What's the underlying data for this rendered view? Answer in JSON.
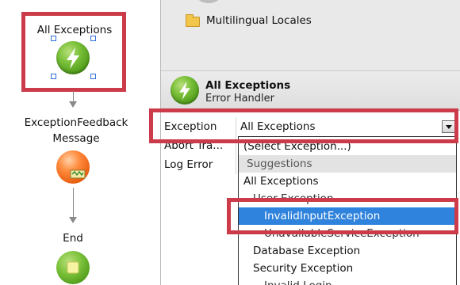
{
  "flow": {
    "start_label": "All Exceptions",
    "feedback_label_line1": "ExceptionFeedback",
    "feedback_label_line2": "Message",
    "end_label": "End"
  },
  "tree": {
    "folder_label": "Multilingual Locales"
  },
  "header": {
    "title": "All Exceptions",
    "subtitle": "Error Handler"
  },
  "properties": [
    {
      "name": "Exception",
      "value": "All Exceptions"
    },
    {
      "name": "Abort Tra...",
      "value": ""
    },
    {
      "name": "Log Error",
      "value": ""
    }
  ],
  "dropdown": {
    "items": [
      {
        "label": "(Select Exception...)"
      },
      {
        "label": "Suggestions"
      },
      {
        "label": "All Exceptions"
      },
      {
        "label": "User Exception"
      },
      {
        "label": "InvalidInputException"
      },
      {
        "label": "UnavailableServiceException"
      },
      {
        "label": "Database Exception"
      },
      {
        "label": "Security Exception"
      },
      {
        "label": "Invalid Login"
      }
    ]
  },
  "colors": {
    "highlight_box": "#cc3b4a",
    "selection": "#2f83dd"
  }
}
